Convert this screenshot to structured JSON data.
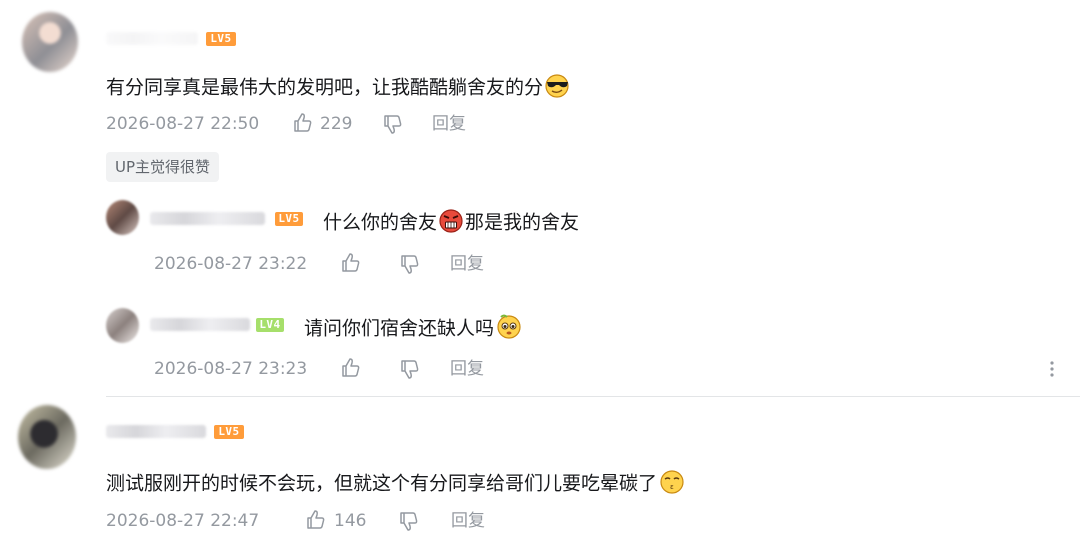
{
  "comments": [
    {
      "level": "LV5",
      "text": "有分同享真是最伟大的发明吧，让我酷酷躺舍友的分",
      "emoji": "cool-face-emoji",
      "time": "2026-08-27 22:50",
      "likes": "229",
      "reply_label": "回复",
      "up_badge": "UP主觉得很赞",
      "replies": [
        {
          "level": "LV5",
          "text_before": "什么你的舍友",
          "emoji": "angry-face-emoji",
          "text_after": "那是我的舍友",
          "time": "2026-08-27 23:22",
          "reply_label": "回复"
        },
        {
          "level": "LV4",
          "text_before": "请问你们宿舍还缺人吗",
          "emoji": "pleading-face-emoji",
          "time": "2026-08-27 23:23",
          "reply_label": "回复"
        }
      ]
    },
    {
      "level": "LV5",
      "text": "测试服刚开的时候不会玩，但就这个有分同享给哥们儿要吃晕碳了",
      "emoji": "smug-face-emoji",
      "time": "2026-08-27 22:47",
      "likes": "146",
      "reply_label": "回复"
    }
  ],
  "colors": {
    "text": "#18191c",
    "meta": "#9499a0",
    "lv5": "#ff9c3a",
    "lv4": "#a6df6b"
  }
}
